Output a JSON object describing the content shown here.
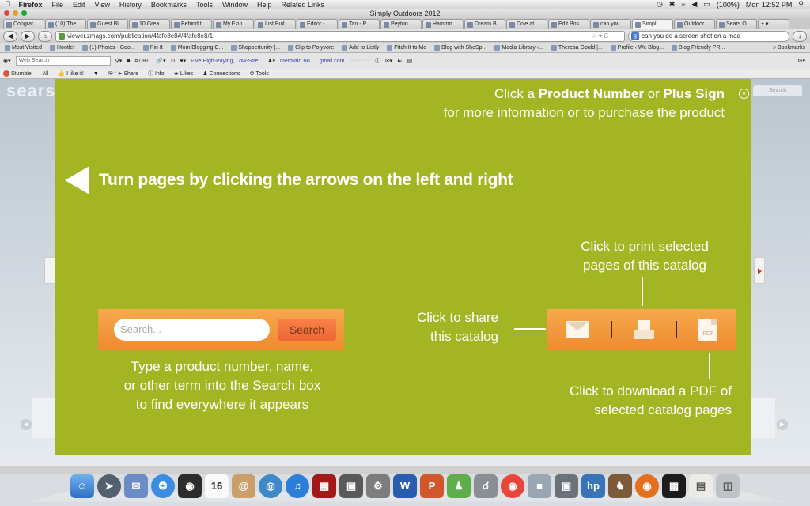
{
  "menubar": {
    "apple": "",
    "items": [
      "Firefox",
      "File",
      "Edit",
      "View",
      "History",
      "Bookmarks",
      "Tools",
      "Window",
      "Help",
      "Related Links"
    ],
    "battery": "(100%)",
    "clock": "Mon 12:52 PM"
  },
  "window": {
    "title": "Simply Outdoors 2012"
  },
  "tabs": [
    "Congrat...",
    "(10) The...",
    "Guest Bl...",
    "10 Grea...",
    "Behind t...",
    "My.Ezin...",
    "List Buil...",
    "Editor -...",
    "Tan - P...",
    "Peyton ...",
    "Hammo...",
    "Dream B...",
    "Dole at ...",
    "Edit Pos...",
    "can you ...",
    "Simpl...",
    "Outdoor...",
    "Sears O..."
  ],
  "nav": {
    "url": "viewer.zmags.com/publication/4fafe8e8#/4fafe8e8/1",
    "search_value": "can you do a screen shot on a mac"
  },
  "bookmarks": [
    "Most Visited",
    "Hootlet",
    "(1) Photos - Goo...",
    "Pin It",
    "Mom Blogging C...",
    "Shoppertunity |...",
    "Clip to Polyvore",
    "Add to Listly",
    "Pitch It to Me",
    "Blog with SheSp...",
    "Media Library ‹...",
    "Theresa Gould |...",
    "Profile ‹ We Blog...",
    "Blog Friendly PR..."
  ],
  "bookmarks_right": "Bookmarks",
  "toolbar1": {
    "web_search_placeholder": "Web Search",
    "count": "#7,811",
    "link1": "Five High-Paying, Low-Stre...",
    "link2": "mermaid Bo...",
    "link3": "gmail.com"
  },
  "toolbar2": [
    "Stumble!",
    "All",
    "I like it!",
    "Share",
    "Info",
    "Likes",
    "Connections",
    "Tools"
  ],
  "background": {
    "logo": "sears",
    "search_button": "Search"
  },
  "overlay": {
    "top_help_line1_prefix": "Click a ",
    "top_help_line1_b1": "Product Number",
    "top_help_line1_mid": " or ",
    "top_help_line1_b2": "Plus Sign",
    "top_help_line2": "for more information or to purchase the product",
    "turn_pages": "Turn pages by clicking the arrows on the left and right",
    "search_placeholder": "Search...",
    "search_button": "Search",
    "search_help_1": "Type a product number, name,",
    "search_help_2": "or other term into the Search box",
    "search_help_3": "to find everywhere it appears",
    "share_help_1": "Click to share",
    "share_help_2": "this catalog",
    "print_help_1": "Click to print selected",
    "print_help_2": "pages of this catalog",
    "pdf_icon_label": "PDF",
    "pdf_help_1": "Click to download a PDF of",
    "pdf_help_2": "selected catalog pages"
  },
  "dock": {
    "calendar_day": "16",
    "items": [
      "finder",
      "launchpad",
      "mail-stamp",
      "safari",
      "facetime",
      "calendar",
      "address-book",
      "globe",
      "itunes",
      "photo-booth",
      "iphoto",
      "system-preferences",
      "word",
      "powerpoint",
      "messenger",
      "satellite",
      "chrome",
      "preview",
      "image-capture",
      "hp-utility",
      "chess",
      "firefox",
      "printer",
      "documents",
      "trash"
    ]
  }
}
